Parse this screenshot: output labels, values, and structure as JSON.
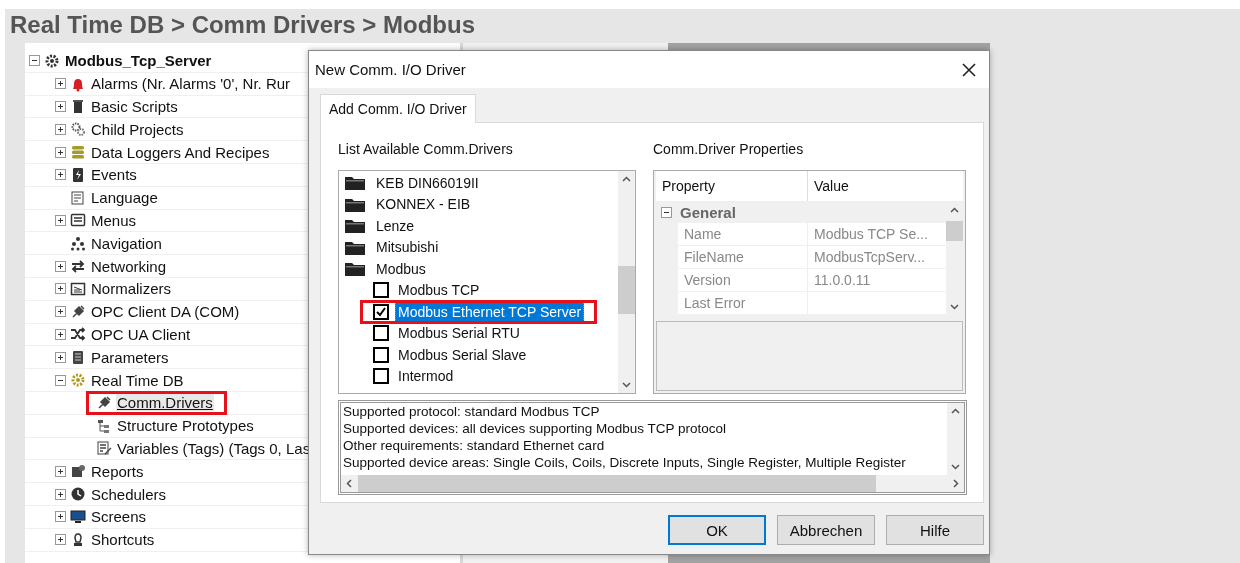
{
  "heading": "Real Time DB > Comm Drivers > Modbus",
  "tree": [
    {
      "label": "Modbus_Tcp_Server",
      "expanded": true,
      "selected": false,
      "highlighted": false,
      "children": [
        {
          "label": "Alarms (Nr. Alarms '0', Nr. Rur",
          "expanded": false,
          "selected": false,
          "highlighted": false
        },
        {
          "label": "Basic Scripts",
          "expanded": false,
          "selected": false,
          "highlighted": false
        },
        {
          "label": "Child Projects",
          "expanded": false,
          "selected": false,
          "highlighted": false
        },
        {
          "label": "Data Loggers And Recipes",
          "expanded": false,
          "selected": false,
          "highlighted": false
        },
        {
          "label": "Events",
          "expanded": false,
          "selected": false,
          "highlighted": false
        },
        {
          "label": "Language",
          "selected": false,
          "highlighted": false
        },
        {
          "label": "Menus",
          "expanded": false,
          "selected": false,
          "highlighted": false
        },
        {
          "label": "Navigation",
          "selected": false,
          "highlighted": false
        },
        {
          "label": "Networking",
          "expanded": false,
          "selected": false,
          "highlighted": false
        },
        {
          "label": "Normalizers",
          "expanded": false,
          "selected": false,
          "highlighted": false
        },
        {
          "label": "OPC Client DA (COM)",
          "expanded": false,
          "selected": false,
          "highlighted": false
        },
        {
          "label": "OPC UA Client",
          "expanded": false,
          "selected": false,
          "highlighted": false
        },
        {
          "label": "Parameters",
          "expanded": false,
          "selected": false,
          "highlighted": false
        },
        {
          "label": "Real Time DB",
          "expanded": true,
          "selected": false,
          "highlighted": false,
          "children": [
            {
              "label": "Comm.Drivers",
              "selected": true,
              "highlighted": true
            },
            {
              "label": "Structure Prototypes",
              "selected": false,
              "highlighted": false
            },
            {
              "label": "Variables (Tags) (Tags 0, Las",
              "selected": false,
              "highlighted": false
            }
          ]
        },
        {
          "label": "Reports",
          "expanded": false,
          "selected": false,
          "highlighted": false
        },
        {
          "label": "Schedulers",
          "expanded": false,
          "selected": false,
          "highlighted": false
        },
        {
          "label": "Screens",
          "expanded": false,
          "selected": false,
          "highlighted": false
        },
        {
          "label": "Shortcuts",
          "expanded": false,
          "selected": false,
          "highlighted": false
        }
      ]
    }
  ],
  "dialog": {
    "title": "New Comm. I/O Driver",
    "tabs": [
      {
        "label": "Add Comm. I/O Driver",
        "selected": true
      }
    ],
    "driver_list": {
      "label": "List Available Comm.Drivers",
      "items": [
        {
          "kind": "folder",
          "label": "KEB DIN66019II",
          "selected": false
        },
        {
          "kind": "folder",
          "label": "KONNEX - EIB",
          "selected": false
        },
        {
          "kind": "folder",
          "label": "Lenze",
          "selected": false
        },
        {
          "kind": "folder",
          "label": "Mitsubishi",
          "selected": false
        },
        {
          "kind": "folder",
          "label": "Modbus",
          "selected": false
        },
        {
          "kind": "driver",
          "label": "Modbus TCP",
          "checked": false,
          "selected": false,
          "highlighted": false
        },
        {
          "kind": "driver",
          "label": "Modbus Ethernet TCP Server",
          "checked": true,
          "selected": true,
          "highlighted": true
        },
        {
          "kind": "driver",
          "label": "Modbus Serial RTU",
          "checked": false,
          "selected": false,
          "highlighted": false
        },
        {
          "kind": "driver",
          "label": "Modbus Serial Slave",
          "checked": false,
          "selected": false,
          "highlighted": false
        },
        {
          "kind": "driver",
          "label": "Intermod",
          "checked": false,
          "selected": false,
          "highlighted": false
        }
      ]
    },
    "properties": {
      "label": "Comm.Driver Properties",
      "columns": [
        "Property",
        "Value"
      ],
      "group": {
        "label": "General",
        "expanded": true
      },
      "rows": [
        {
          "property": "Name",
          "value": "Modbus TCP Se..."
        },
        {
          "property": "FileName",
          "value": "ModbusTcpServ..."
        },
        {
          "property": "Version",
          "value": "11.0.0.11"
        },
        {
          "property": "Last Error"
        }
      ]
    },
    "description": [
      "Supported protocol: standard Modbus TCP",
      "Supported devices: all devices supporting Modbus TCP protocol",
      "Other requirements: standard Ethernet card",
      "Supported device areas: Single Coils, Coils, Discrete Inputs, Single Register, Multiple Register"
    ],
    "buttons": [
      {
        "label": "OK",
        "default": true
      },
      {
        "label": "Abbrechen",
        "default": false
      },
      {
        "label": "Hilfe",
        "default": false
      }
    ]
  }
}
